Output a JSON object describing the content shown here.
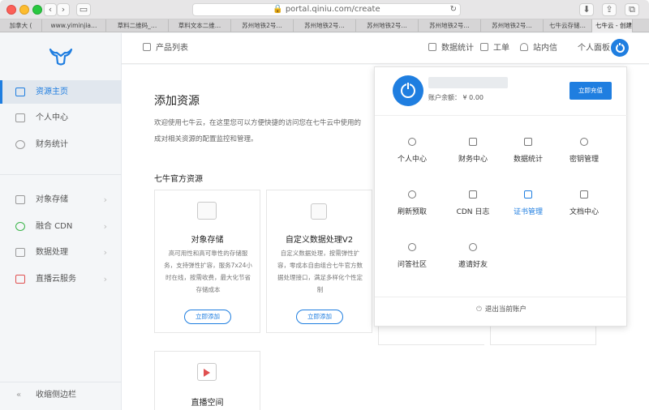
{
  "browser": {
    "url": "portal.qiniu.com/create",
    "tabs": [
      "加拿大 (",
      "www.yiminjia…",
      "草料二维码_…",
      "草料文本二维…",
      "苏州地铁2号…",
      "苏州地铁2号…",
      "苏州地铁2号…",
      "苏州地铁2号…",
      "苏州地铁2号…",
      "七牛云存储…",
      "七牛云 - 创建…"
    ],
    "active_tab": 10
  },
  "sidebar": {
    "items": [
      {
        "label": "资源主页",
        "active": true
      },
      {
        "label": "个人中心"
      },
      {
        "label": "财务统计"
      },
      {
        "label": "对象存储",
        "chevron": true
      },
      {
        "label": "融合 CDN",
        "chevron": true
      },
      {
        "label": "数据处理",
        "chevron": true
      },
      {
        "label": "直播云服务",
        "chevron": true
      }
    ],
    "collapse_label": "收缩侧边栏"
  },
  "header": {
    "product_list": "产品列表",
    "stats": "数据统计",
    "ticket": "工单",
    "inbox": "站内信",
    "panel": "个人面板"
  },
  "main": {
    "title": "添加资源",
    "desc_line1": "欢迎使用七牛云，在这里您可以方便快捷的访问您在七牛云中使用的",
    "desc_line2": "成对相关资源的配置监控和管理。",
    "section": "七牛官方资源",
    "cards": [
      {
        "title": "对象存储",
        "desc": "高可用性和高可靠性的存储服务，支持弹性扩容，服务7x24小时在线，按需收费，最大化节省存储成本",
        "button": "立即添加"
      },
      {
        "title": "自定义数据处理V2",
        "desc": "自定义数据处理，按需弹性扩容，零成本自由组合七牛官方数据处理接口，满足多样化个性定制",
        "button": "立即添加"
      },
      {
        "title": "直播空间"
      }
    ]
  },
  "dropdown": {
    "balance_label": "账户余额：",
    "balance_value": "¥ 0.00",
    "recharge": "立即充值",
    "items": [
      "个人中心",
      "财务中心",
      "数据统计",
      "密钥管理",
      "刷新预取",
      "CDN 日志",
      "证书管理",
      "文档中心",
      "问答社区",
      "邀请好友"
    ],
    "highlighted": "证书管理",
    "logout": "退出当前账户"
  },
  "colors": {
    "accent": "#1f7ee0"
  }
}
